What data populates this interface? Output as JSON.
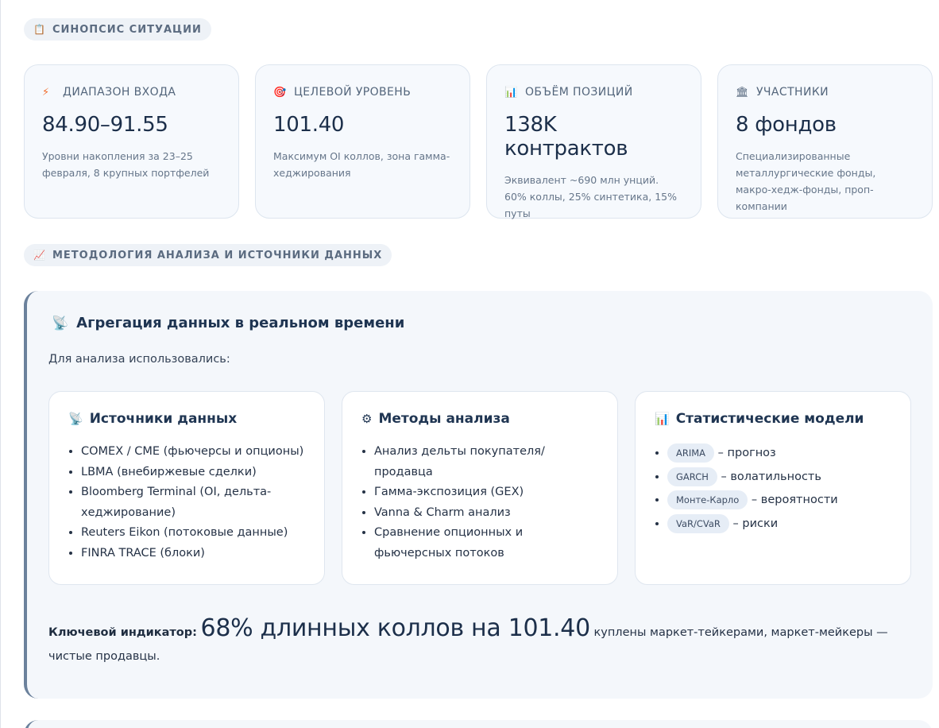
{
  "synopsis": {
    "icon": "clipboard-icon",
    "label": "СИНОПСИС СИТУАЦИИ"
  },
  "cards": [
    {
      "icon": "lightning-icon",
      "label": "ДИАПАЗОН ВХОДА",
      "value": "84.90–91.55",
      "desc": "Уровни накопления за 23–25 февраля, 8 крупных портфелей"
    },
    {
      "icon": "target-icon",
      "label": "ЦЕЛЕВОЙ УРОВЕНЬ",
      "value": "101.40",
      "desc": "Максимум OI коллов, зона гамма-хеджирования"
    },
    {
      "icon": "bar-chart-icon",
      "label": "ОБЪЁМ ПОЗИЦИЙ",
      "value": "138K контрактов",
      "desc": "Эквивалент ~690 млн унций. 60% коллы, 25% синтетика, 15% путы"
    },
    {
      "icon": "bank-icon",
      "label": "УЧАСТНИКИ",
      "value": "8 фондов",
      "desc": "Специализированные металлургические фонды, макро-хедж-фонды, проп-компании"
    }
  ],
  "methodology": {
    "icon": "chart-increasing-icon",
    "label": "МЕТОДОЛОГИЯ АНАЛИЗА И ИСТОЧНИКИ ДАННЫХ"
  },
  "panel": {
    "icon": "satellite-icon",
    "title": "Агрегация данных в реальном времени",
    "intro": "Для анализа использовались:",
    "columns": {
      "sources": {
        "icon": "satellite-icon",
        "title": "Источники данных",
        "items": [
          "COMEX / CME (фьючерсы и опционы)",
          "LBMA (внебиржевые сделки)",
          "Bloomberg Terminal (OI, дельта-хеджирование)",
          "Reuters Eikon (потоковые данные)",
          "FINRA TRACE (блоки)"
        ]
      },
      "methods": {
        "icon": "gear-icon",
        "title": "Методы анализа",
        "items": [
          "Анализ дельты покупателя/продавца",
          "Гамма-экспозиция (GEX)",
          "Vanna & Charm анализ",
          "Сравнение опционных и фьючерсных потоков"
        ]
      },
      "models": {
        "icon": "bar-chart-icon",
        "title": "Статистические модели",
        "items": [
          {
            "tag": "ARIMA",
            "text": "– прогноз"
          },
          {
            "tag": "GARCH",
            "text": "– волатильность"
          },
          {
            "tag": "Монте-Карло",
            "text": "– вероятности"
          },
          {
            "tag": "VaR/CVaR",
            "text": "– риски"
          }
        ]
      }
    },
    "key": {
      "label": "Ключевой индикатор:",
      "big": "68% длинных коллов на 101.40",
      "rest": "куплены маркет-тейкерами, маркет-мейкеры — чистые продавцы."
    }
  }
}
